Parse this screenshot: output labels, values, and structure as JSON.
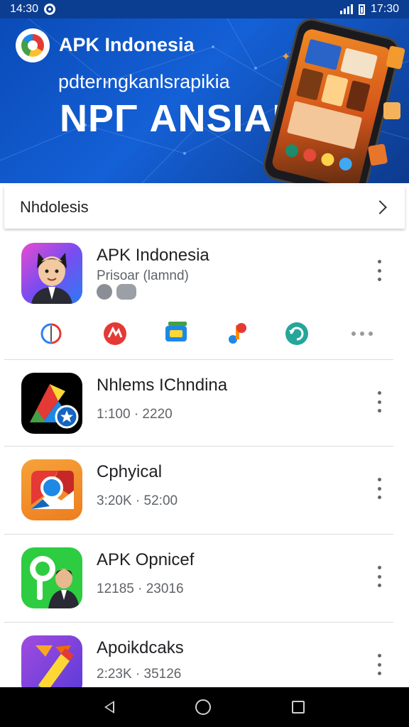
{
  "status_bar": {
    "time": "14:30",
    "battery_time": "17:30"
  },
  "banner": {
    "brand_name": "APK Indonesia",
    "subtitle": "pdterıngkanlsrapikia",
    "headline": "NPΓ ANSIAK"
  },
  "category": {
    "title": "Nhdolesis"
  },
  "featured_app": {
    "name": "APK Indonesia",
    "subtitle": "Prisoar (lamnd)",
    "share_icons": [
      "pinterest-icon",
      "brand-red-icon",
      "cast-icon",
      "music-note-icon",
      "refresh-icon",
      "more-icon"
    ]
  },
  "apps": [
    {
      "name": "Nhlems IChndina",
      "meta": "1:100 · 2220",
      "icon": "maps-icon"
    },
    {
      "name": "Cphyical",
      "meta": "3:20K · 52:00",
      "icon": "chrome-icon"
    },
    {
      "name": "APK Opnicef",
      "meta": "12185 · 23016",
      "icon": "person-app-icon"
    },
    {
      "name": "Apoikdcaks",
      "meta": "2:23K · 35126",
      "icon": "pencil-app-icon"
    }
  ],
  "colors": {
    "banner_blue": "#1460d6",
    "status_blue": "#0b3d91",
    "text_primary": "#202124",
    "text_secondary": "#5f6368"
  }
}
